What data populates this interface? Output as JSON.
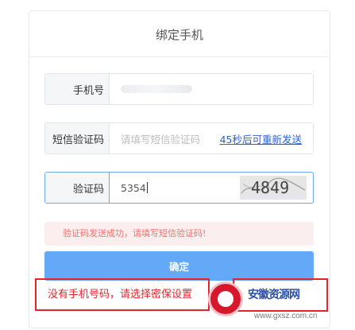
{
  "dialog": {
    "title": "绑定手机"
  },
  "form": {
    "phone": {
      "label": "手机号",
      "value": ""
    },
    "sms_code": {
      "label": "短信验证码",
      "placeholder": "请填写短信验证码",
      "resend_link": "45秒后可重新发送"
    },
    "captcha": {
      "label": "验证码",
      "value": "5354",
      "image_text": "4849"
    }
  },
  "alert": {
    "message": "验证码发送成功，请填写短信验证码!"
  },
  "buttons": {
    "confirm": "确定"
  },
  "links": {
    "no_phone": "没有手机号码，请选择密保设置"
  },
  "watermark": {
    "brand": "安徽资源网",
    "url": "www.gxsz.com.cn"
  },
  "colors": {
    "primary_button": "#63a9f7",
    "link": "#2a62d8",
    "alert_text": "#f37272",
    "alert_bg": "#fbeeee",
    "highlight_red": "#e8232c"
  }
}
